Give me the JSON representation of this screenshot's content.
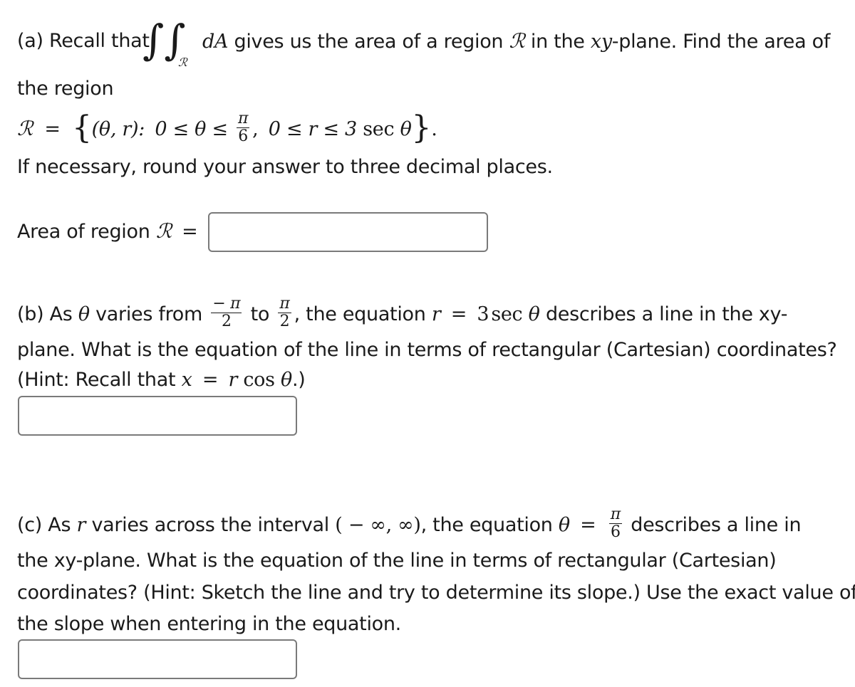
{
  "part_a": {
    "intro_1": "(a) Recall that",
    "integral_symbol": "∫∫",
    "integral_subscript": "ℛ",
    "differential": "dA",
    "intro_2": "gives us the area of a region",
    "region_symbol": "ℛ",
    "intro_3": "in the",
    "xy": "xy",
    "intro_4": "-plane. Find the area of",
    "line2": "the region",
    "set_def": {
      "lhs": "ℛ",
      "equals": "=",
      "open_brace": "{",
      "pair": "(θ, r):",
      "cond1": "0 ≤ θ ≤",
      "frac1_num": "π",
      "frac1_den": "6",
      "sep": ",",
      "cond2": "0 ≤ r ≤ 3",
      "sec": "sec",
      "theta": "θ",
      "close_brace": "}",
      "period": "."
    },
    "rounding_note": "If necessary, round your answer to three decimal places.",
    "answer_label": "Area of region",
    "answer_symbol": "ℛ",
    "answer_equals": "=",
    "answer_value": ""
  },
  "part_b": {
    "t1": "(b) As",
    "theta": "θ",
    "t2": "varies from",
    "from_num": "− π",
    "from_den": "2",
    "t3": "to",
    "to_num": "π",
    "to_den": "2",
    "t4": ", the equation",
    "r": "r",
    "eq": "=",
    "rhs_coef": "3",
    "rhs_sec": "sec",
    "rhs_theta": "θ",
    "t5": "describes a line in the xy-",
    "line2": "plane. What is the equation of the line in terms of rectangular (Cartesian) coordinates?",
    "hint_1": "(Hint: Recall that",
    "hint_x": "x",
    "hint_eq": "=",
    "hint_r": "r",
    "hint_cos": "cos",
    "hint_theta": "θ",
    "hint_2": ".)",
    "answer_value": ""
  },
  "part_c": {
    "t1": "(c) As",
    "r": "r",
    "t2": "varies across the interval",
    "interval": "( − ∞, ∞)",
    "t3": ", the equation",
    "theta": "θ",
    "eq": "=",
    "frac_num": "π",
    "frac_den": "6",
    "t4": "describes a line in",
    "line2": "the xy-plane. What is the equation of the line in terms of rectangular (Cartesian)",
    "line3": "coordinates? (Hint: Sketch the line and try to determine its slope.) Use the exact value of",
    "line4": "the slope when entering in the equation.",
    "answer_value": ""
  }
}
